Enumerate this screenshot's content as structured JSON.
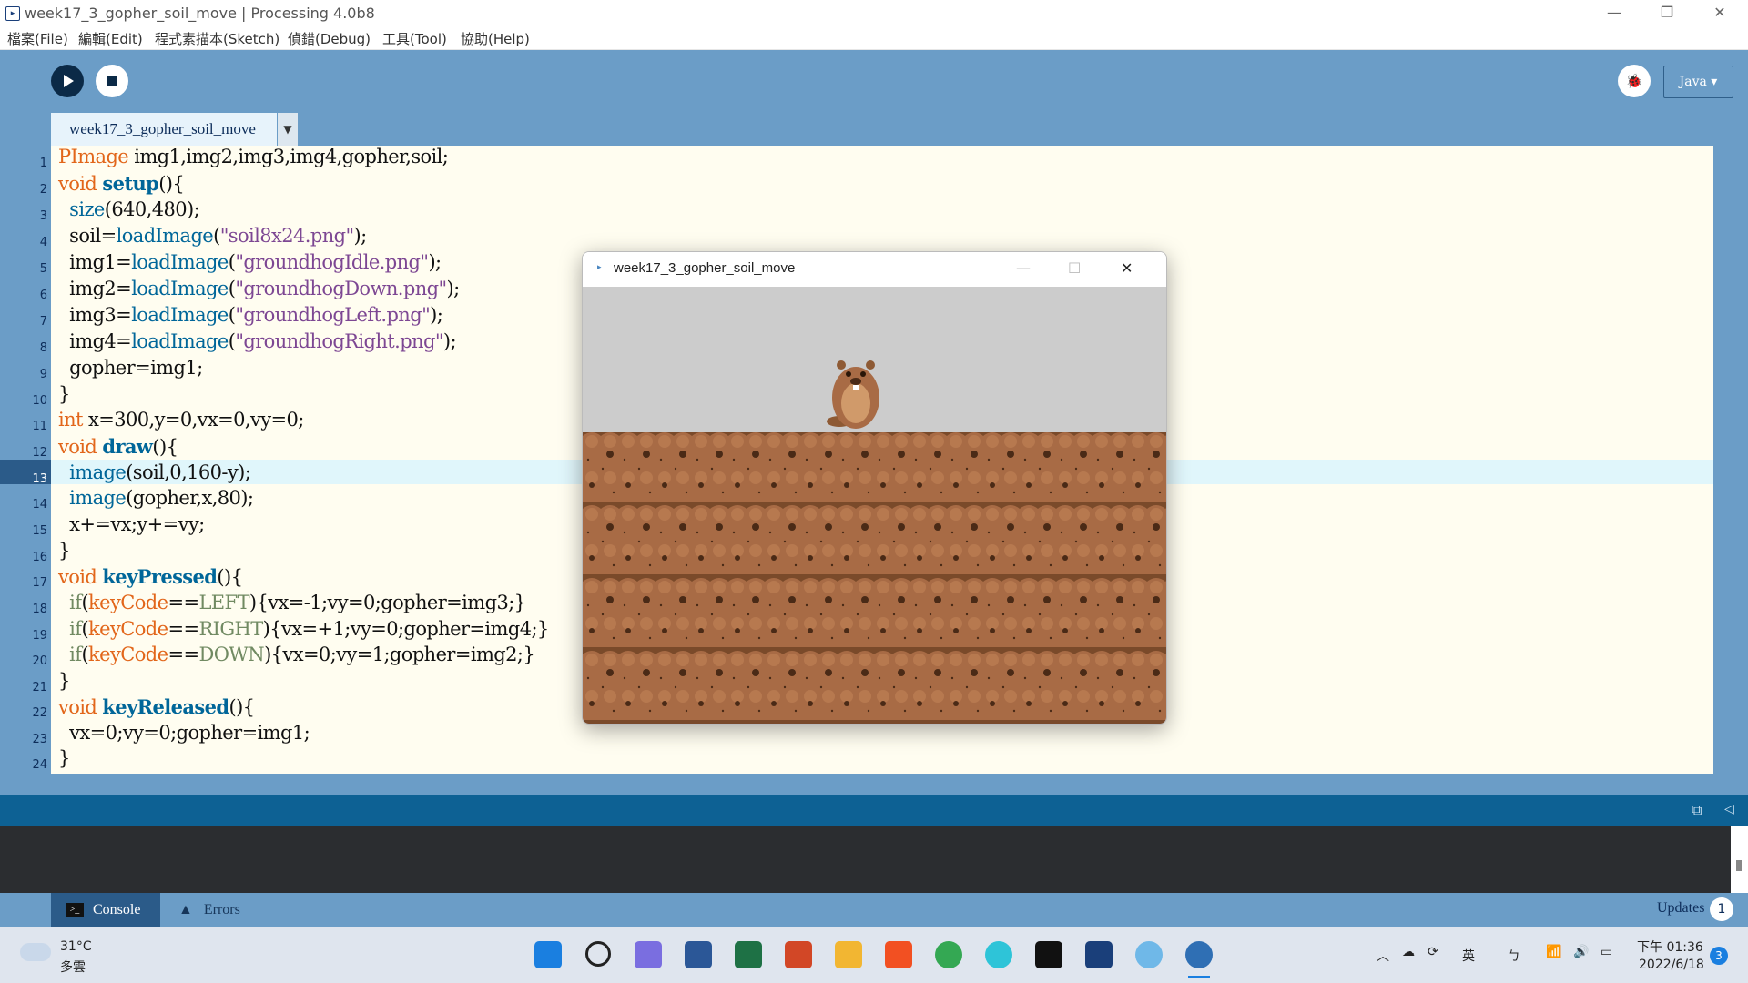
{
  "window": {
    "title": "week17_3_gopher_soil_move | Processing 4.0b8",
    "app_icon": "processing-icon",
    "minimize": "—",
    "restore": "❐",
    "close": "✕"
  },
  "menu": [
    "檔案(File)",
    "編輯(Edit)",
    "程式素描本(Sketch)",
    "偵錯(Debug)",
    "工具(Tool)",
    "協助(Help)"
  ],
  "toolbar": {
    "run_icon": "play-icon",
    "stop_icon": "stop-icon",
    "debug_label": "🐞",
    "mode": "Java ▾"
  },
  "tab": {
    "label": "week17_3_gopher_soil_move",
    "menu_label": "▼"
  },
  "editor": {
    "current_line": 13,
    "line_numbers": [
      "1",
      "2",
      "3",
      "4",
      "5",
      "6",
      "7",
      "8",
      "9",
      "10",
      "11",
      "12",
      "13",
      "14",
      "15",
      "16",
      "17",
      "18",
      "19",
      "20",
      "21",
      "22",
      "23",
      "24"
    ]
  },
  "sketch_window": {
    "title": "week17_3_gopher_soil_move",
    "minimize": "—",
    "maximize": "☐",
    "close": "✕"
  },
  "footer": {
    "console_tab": "Console",
    "errors_tab": "Errors",
    "updates_label": "Updates",
    "updates_count": "1"
  },
  "taskbar": {
    "weather_temp": "31°C",
    "weather_desc": "多雲",
    "ime": "英",
    "time": "下午 01:36",
    "date": "2022/6/18",
    "notifications": "3",
    "pinned": [
      "windows-start-icon",
      "search-icon",
      "teams-chat-icon",
      "word-icon",
      "excel-icon",
      "powerpoint-icon",
      "file-explorer-icon",
      "microsoft-store-icon",
      "chrome-icon",
      "kmplayer-icon",
      "netflix-icon",
      "processing-app-icon",
      "paint-icon",
      "processing-running-icon"
    ]
  },
  "colors": {
    "ide_blue": "#6b9dc7",
    "status_blue": "#0d6194",
    "editor_bg": "#fffdf0",
    "keyword_orange": "#e2661a",
    "function_blue": "#006699",
    "string_purple": "#7d4793"
  }
}
